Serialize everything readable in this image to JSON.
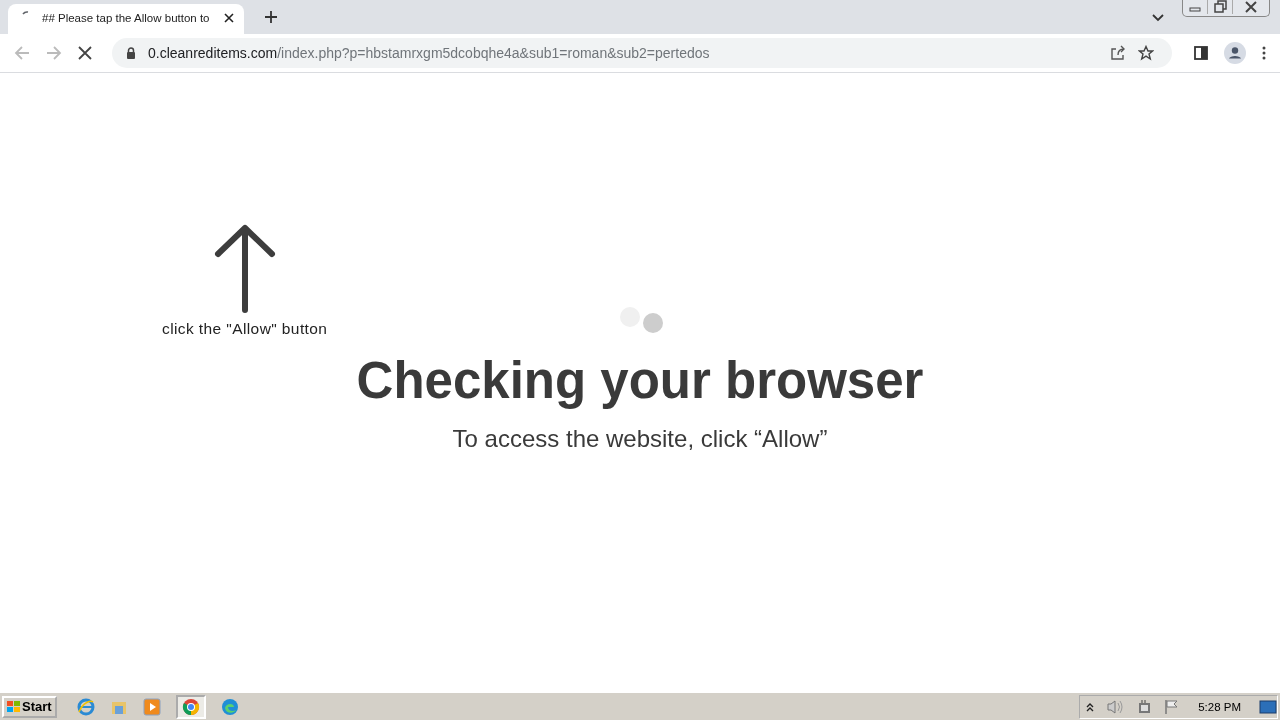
{
  "tab": {
    "title": "## Please tap the Allow button to"
  },
  "address_bar": {
    "host": "0.cleanreditems.com",
    "path": "/index.php?p=hbstamrxgm5dcobqhe4a&sub1=roman&sub2=pertedos"
  },
  "page": {
    "hint": "click the \"Allow\" button",
    "heading": "Checking your browser",
    "subtitle": "To access the website, click “Allow”"
  },
  "taskbar": {
    "start": "Start",
    "clock": "5:28 PM"
  }
}
